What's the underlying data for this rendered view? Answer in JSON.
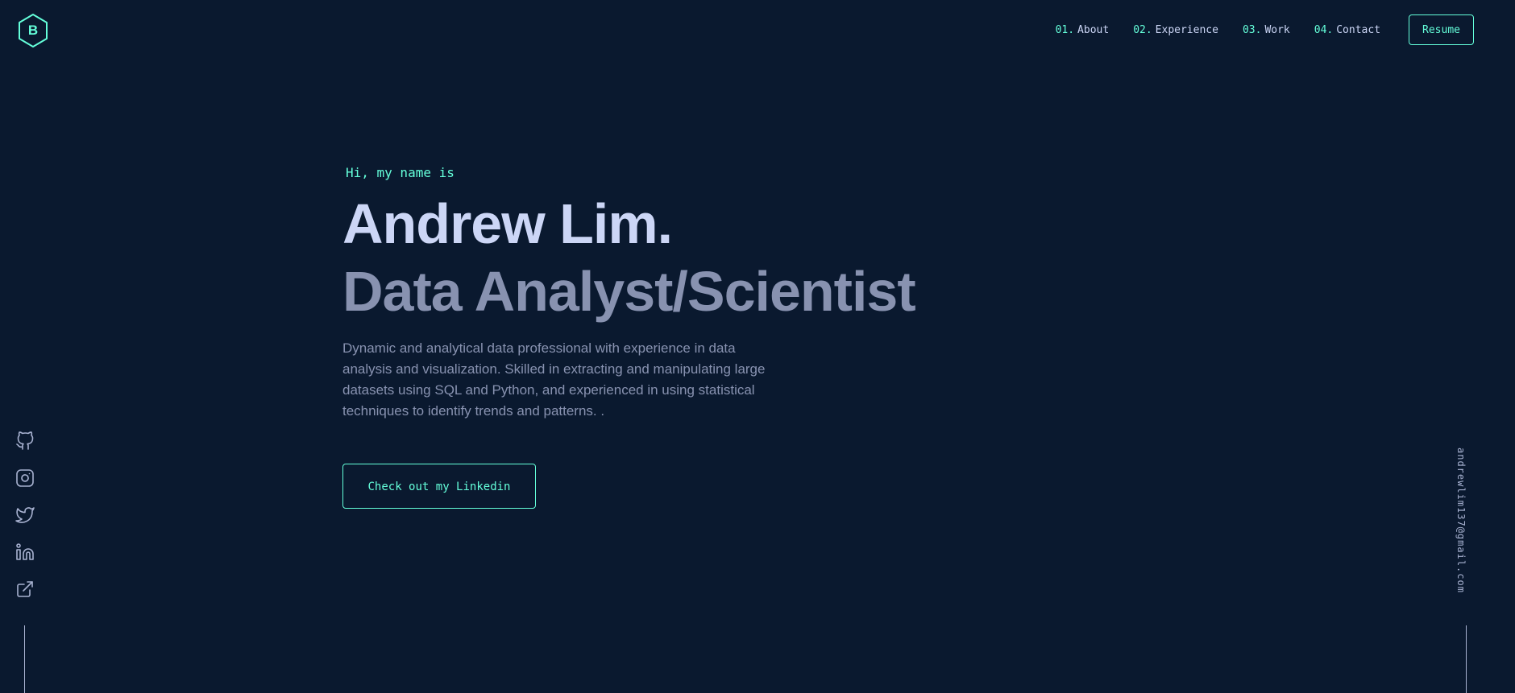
{
  "logo": {
    "letter": "B",
    "icon": "hexagon-logo-icon"
  },
  "nav": {
    "items": [
      {
        "num": "01.",
        "label": "About"
      },
      {
        "num": "02.",
        "label": "Experience"
      },
      {
        "num": "03.",
        "label": "Work"
      },
      {
        "num": "04.",
        "label": "Contact"
      }
    ],
    "resume_label": "Resume"
  },
  "hero": {
    "greeting": "Hi, my name is",
    "name": "Andrew Lim.",
    "role": "Data Analyst/Scientist",
    "bio": "Dynamic and analytical data professional with experience in data analysis and visualization. Skilled in extracting and manipulating large datasets using SQL and Python, and experienced in using statistical techniques to identify trends and patterns. .",
    "cta_label": "Check out my Linkedin"
  },
  "social": {
    "icons": [
      "github-icon",
      "instagram-icon",
      "twitter-icon",
      "linkedin-icon",
      "external-link-icon"
    ]
  },
  "email": "andrewlim137@gmail.com",
  "colors": {
    "background": "#0a192f",
    "accent": "#64ffda",
    "heading": "#ccd6f6",
    "text": "#8892b0",
    "muted_light": "#a8b2d1"
  }
}
